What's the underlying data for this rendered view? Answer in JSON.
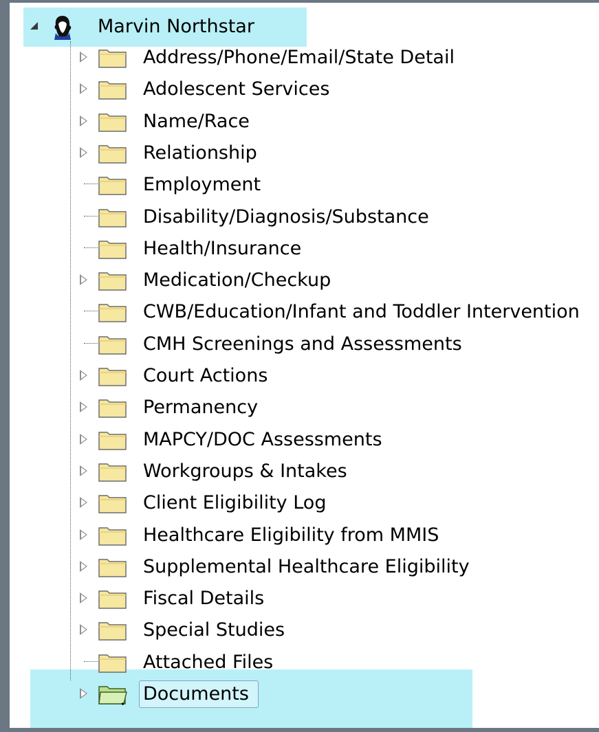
{
  "tree": {
    "root": {
      "label": "Marvin Northstar",
      "icon": "person-icon"
    },
    "items": [
      {
        "label": "Address/Phone/Email/State Detail",
        "expandable": true
      },
      {
        "label": "Adolescent Services",
        "expandable": true
      },
      {
        "label": "Name/Race",
        "expandable": true
      },
      {
        "label": "Relationship",
        "expandable": true
      },
      {
        "label": "Employment",
        "expandable": false
      },
      {
        "label": "Disability/Diagnosis/Substance",
        "expandable": false
      },
      {
        "label": "Health/Insurance",
        "expandable": false
      },
      {
        "label": "Medication/Checkup",
        "expandable": true
      },
      {
        "label": "CWB/Education/Infant and Toddler Intervention",
        "expandable": false
      },
      {
        "label": "CMH Screenings and Assessments",
        "expandable": false
      },
      {
        "label": "Court Actions",
        "expandable": true
      },
      {
        "label": "Permanency",
        "expandable": true
      },
      {
        "label": "MAPCY/DOC Assessments",
        "expandable": true
      },
      {
        "label": "Workgroups & Intakes",
        "expandable": true
      },
      {
        "label": "Client Eligibility Log",
        "expandable": true
      },
      {
        "label": "Healthcare Eligibility from MMIS",
        "expandable": true
      },
      {
        "label": "Supplemental Healthcare Eligibility",
        "expandable": true
      },
      {
        "label": "Fiscal Details",
        "expandable": true
      },
      {
        "label": "Special Studies",
        "expandable": true
      },
      {
        "label": "Attached Files",
        "expandable": false
      },
      {
        "label": "Documents",
        "expandable": true,
        "selected": true,
        "icon": "open-folder-icon"
      }
    ]
  },
  "colors": {
    "highlight": "#b9f0f7",
    "folder_fill": "#f6e7a1",
    "folder_border": "#6d6d6d",
    "open_folder_fill": "#b9e08a",
    "frame": "#6b7783"
  }
}
